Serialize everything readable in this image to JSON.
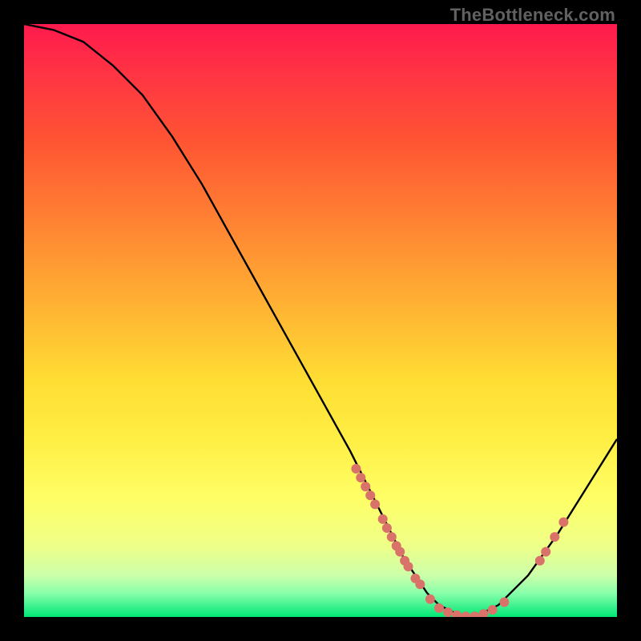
{
  "watermark": "TheBottleneck.com",
  "chart_data": {
    "type": "line",
    "title": "",
    "xlabel": "",
    "ylabel": "",
    "xlim": [
      0,
      100
    ],
    "ylim": [
      0,
      100
    ],
    "series": [
      {
        "name": "curve",
        "x": [
          0,
          5,
          10,
          15,
          20,
          25,
          30,
          35,
          40,
          45,
          50,
          55,
          58,
          60,
          62,
          64,
          66,
          68,
          70,
          72,
          74,
          76,
          80,
          85,
          90,
          95,
          100
        ],
        "y": [
          100,
          99,
          97,
          93,
          88,
          81,
          73,
          64,
          55,
          46,
          37,
          28,
          22,
          18,
          14,
          10,
          7,
          4,
          2,
          1,
          0,
          0,
          2,
          7,
          14,
          22,
          30
        ]
      }
    ],
    "scatter": [
      {
        "x": 56,
        "y": 25,
        "r": 1.0
      },
      {
        "x": 56.8,
        "y": 23.5,
        "r": 1.0
      },
      {
        "x": 57.6,
        "y": 22,
        "r": 1.0
      },
      {
        "x": 58.4,
        "y": 20.5,
        "r": 1.0
      },
      {
        "x": 59.2,
        "y": 19,
        "r": 1.0
      },
      {
        "x": 60.5,
        "y": 16.5,
        "r": 1.0
      },
      {
        "x": 61.2,
        "y": 15,
        "r": 1.0
      },
      {
        "x": 62,
        "y": 13.5,
        "r": 1.0
      },
      {
        "x": 62.8,
        "y": 12,
        "r": 1.0
      },
      {
        "x": 63.4,
        "y": 11,
        "r": 1.0
      },
      {
        "x": 64.2,
        "y": 9.5,
        "r": 1.0
      },
      {
        "x": 64.8,
        "y": 8.5,
        "r": 1.0
      },
      {
        "x": 66,
        "y": 6.5,
        "r": 1.0
      },
      {
        "x": 66.8,
        "y": 5.5,
        "r": 1.0
      },
      {
        "x": 68.5,
        "y": 3,
        "r": 1.0
      },
      {
        "x": 70,
        "y": 1.5,
        "r": 1.0
      },
      {
        "x": 71.5,
        "y": 0.8,
        "r": 1.0
      },
      {
        "x": 73,
        "y": 0.3,
        "r": 1.0
      },
      {
        "x": 74.5,
        "y": 0.1,
        "r": 1.0
      },
      {
        "x": 76,
        "y": 0.1,
        "r": 1.0
      },
      {
        "x": 77.5,
        "y": 0.5,
        "r": 1.0
      },
      {
        "x": 79,
        "y": 1.2,
        "r": 1.0
      },
      {
        "x": 81,
        "y": 2.5,
        "r": 1.0
      },
      {
        "x": 87,
        "y": 9.5,
        "r": 1.0
      },
      {
        "x": 88,
        "y": 11,
        "r": 1.0
      },
      {
        "x": 89.5,
        "y": 13.5,
        "r": 1.0
      },
      {
        "x": 91,
        "y": 16,
        "r": 1.0
      }
    ],
    "colors": {
      "curve_stroke": "#000000",
      "point_fill": "#d9736a"
    }
  }
}
